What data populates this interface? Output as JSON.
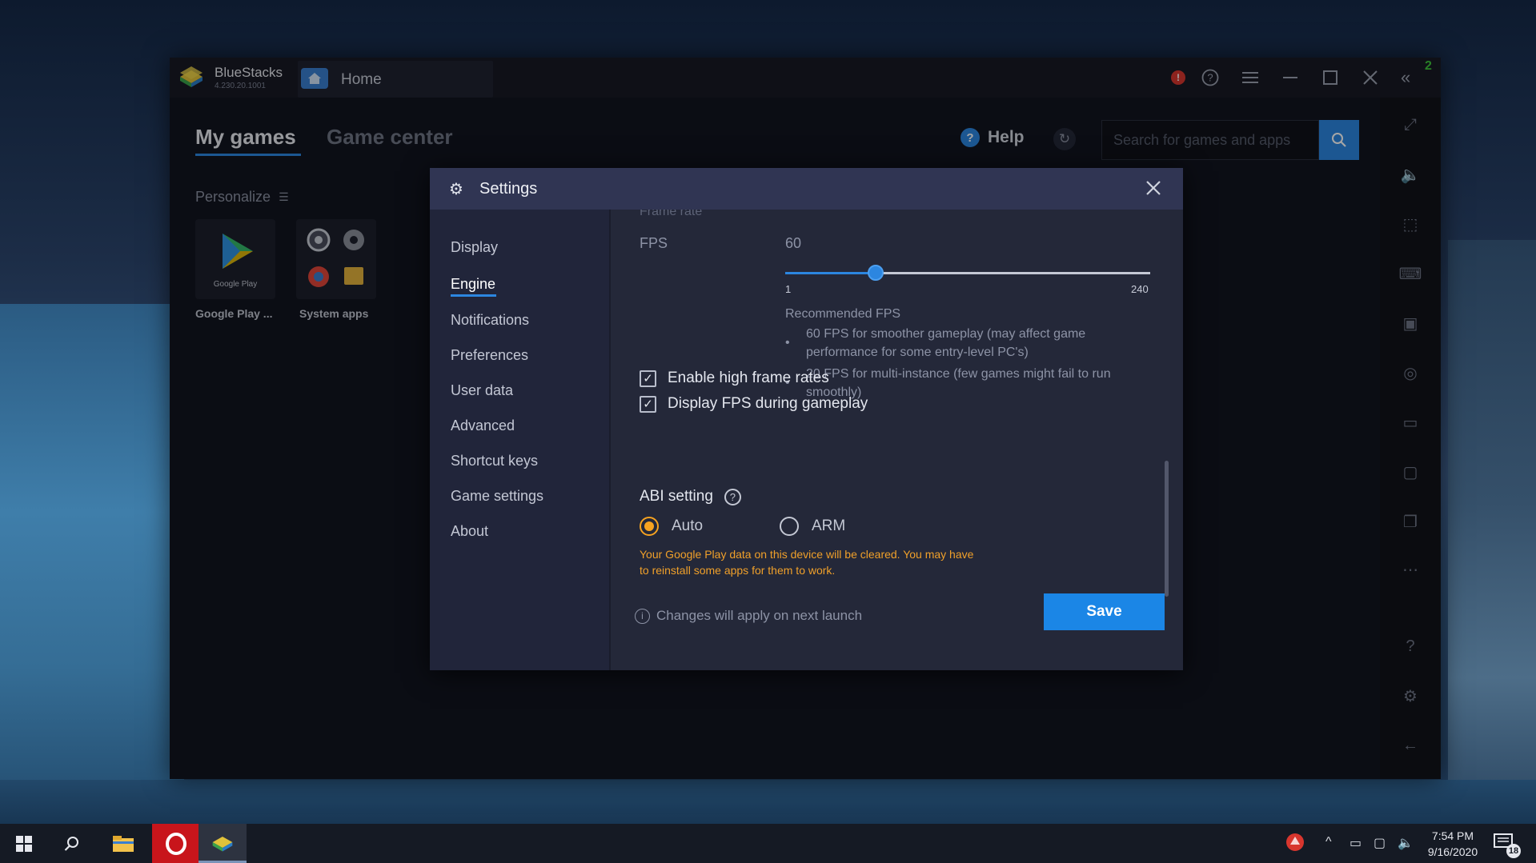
{
  "window": {
    "app_name": "BlueStacks",
    "version": "4.230.20.1001",
    "tab_label": "Home",
    "alert_icon": "alert-icon",
    "green_badge": "2"
  },
  "main": {
    "tabs": [
      {
        "label": "My games",
        "active": true
      },
      {
        "label": "Game center",
        "active": false
      }
    ],
    "help_label": "Help",
    "search_placeholder": "Search for games and apps",
    "personalize_label": "Personalize",
    "apps": [
      {
        "label": "Google Play ...",
        "icon_caption": "Google Play"
      },
      {
        "label": "System apps"
      }
    ]
  },
  "settings": {
    "title": "Settings",
    "menu": [
      {
        "label": "Display",
        "active": false
      },
      {
        "label": "Engine",
        "active": true
      },
      {
        "label": "Notifications",
        "active": false
      },
      {
        "label": "Preferences",
        "active": false
      },
      {
        "label": "User data",
        "active": false
      },
      {
        "label": "Advanced",
        "active": false
      },
      {
        "label": "Shortcut keys",
        "active": false
      },
      {
        "label": "Game settings",
        "active": false
      },
      {
        "label": "About",
        "active": false
      }
    ],
    "section_cut_label": "Frame rate",
    "fps": {
      "label": "FPS",
      "value": "60",
      "min_label": "1",
      "max_label": "240",
      "min": 1,
      "max": 240,
      "current": 60
    },
    "recommended": {
      "title": "Recommended FPS",
      "items": [
        "60 FPS for smoother gameplay (may affect game performance for some entry-level PC's)",
        "20 FPS for multi-instance (few games might fail to run smoothly)"
      ]
    },
    "checkboxes": [
      {
        "label": "Enable high frame rates",
        "checked": true
      },
      {
        "label": "Display FPS during gameplay",
        "checked": true
      }
    ],
    "abi": {
      "title": "ABI setting",
      "options": [
        {
          "label": "Auto",
          "selected": true
        },
        {
          "label": "ARM",
          "selected": false
        }
      ],
      "warning": "Your Google Play data on this device will be cleared. You may have to reinstall some apps for them to work."
    },
    "footer_note": "Changes will apply on next launch",
    "save_label": "Save"
  },
  "taskbar": {
    "time": "7:54 PM",
    "date": "9/16/2020",
    "notification_count": "18"
  },
  "colors": {
    "accent": "#2c86e0",
    "warning": "#f0a02a",
    "radio_selected": "#f7a320",
    "dialog_bg": "#242839",
    "dialog_header": "#303553"
  }
}
